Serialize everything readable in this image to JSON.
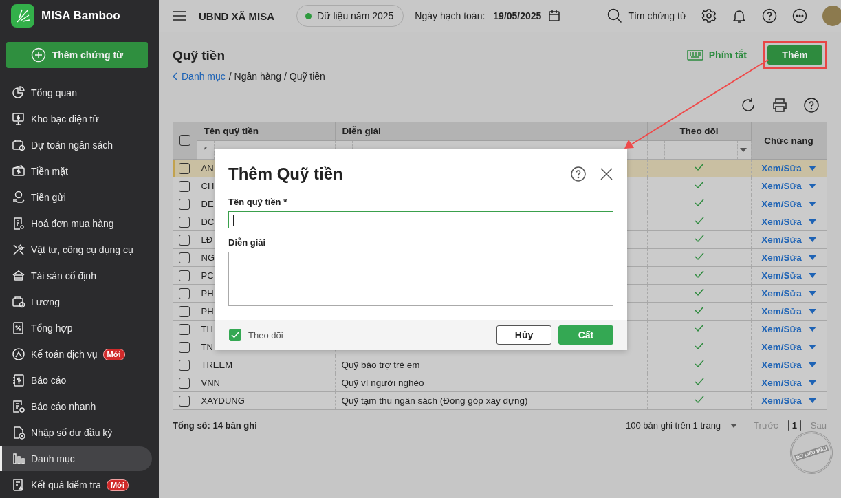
{
  "sidebar": {
    "logo_text": "MISA Bamboo",
    "add_button": "Thêm chứng từ",
    "items": [
      {
        "label": "Tổng quan",
        "selected": false
      },
      {
        "label": "Kho bạc điện tử",
        "selected": false
      },
      {
        "label": "Dự toán ngân sách",
        "selected": false
      },
      {
        "label": "Tiền mặt",
        "selected": false
      },
      {
        "label": "Tiền gửi",
        "selected": false
      },
      {
        "label": "Hoá đơn mua hàng",
        "selected": false
      },
      {
        "label": "Vật tư, công cụ dụng cụ",
        "selected": false
      },
      {
        "label": "Tài sản cố định",
        "selected": false
      },
      {
        "label": "Lương",
        "selected": false
      },
      {
        "label": "Tổng hợp",
        "selected": false
      },
      {
        "label": "Kế toán dịch vụ",
        "badge": "Mới",
        "selected": false
      },
      {
        "label": "Báo cáo",
        "selected": false
      },
      {
        "label": "Báo cáo nhanh",
        "selected": false
      },
      {
        "label": "Nhập số dư đầu kỳ",
        "selected": false
      },
      {
        "label": "Danh mục",
        "selected": true
      },
      {
        "label": "Kết quả kiểm tra",
        "badge": "Mới",
        "selected": false
      }
    ]
  },
  "topbar": {
    "organization": "UBND XÃ MISA",
    "data_year": "Dữ liệu năm 2025",
    "date_label": "Ngày hạch toán:",
    "date_value": "19/05/2025",
    "search_label": "Tìm chứng từ"
  },
  "page": {
    "title": "Quỹ tiền",
    "shortcut_label": "Phím tắt",
    "add_button": "Thêm",
    "highlight_add_button": true,
    "breadcrumb": [
      {
        "label": "Danh mục",
        "link": true
      },
      {
        "label": "/ Ngân hàng / Quỹ tiền",
        "link": false
      }
    ]
  },
  "table": {
    "select_all": false,
    "columns": [
      {
        "label": "Tên quỹ tiền",
        "filter": {
          "kind": "text",
          "op": "*"
        }
      },
      {
        "label": "Diễn giải",
        "filter": {
          "kind": "text"
        }
      },
      {
        "label": "Theo dõi",
        "filter": {
          "kind": "select",
          "op": "="
        }
      },
      {
        "label": "Chức năng"
      }
    ],
    "rows": [
      {
        "name": "AN",
        "selected": true,
        "checked": false,
        "tracked": true,
        "action": "Xem/Sửa"
      },
      {
        "name": "CH",
        "selected": false,
        "checked": false,
        "tracked": true,
        "action": "Xem/Sửa"
      },
      {
        "name": "DE",
        "selected": false,
        "checked": false,
        "tracked": true,
        "action": "Xem/Sửa"
      },
      {
        "name": "DC",
        "selected": false,
        "checked": false,
        "tracked": true,
        "action": "Xem/Sửa"
      },
      {
        "name": "LĐ",
        "selected": false,
        "checked": false,
        "tracked": true,
        "action": "Xem/Sửa"
      },
      {
        "name": "NG",
        "selected": false,
        "checked": false,
        "tracked": true,
        "action": "Xem/Sửa"
      },
      {
        "name": "PC",
        "selected": false,
        "checked": false,
        "tracked": true,
        "action": "Xem/Sửa"
      },
      {
        "name": "PH",
        "selected": false,
        "checked": false,
        "tracked": true,
        "action": "Xem/Sửa"
      },
      {
        "name": "PH",
        "selected": false,
        "checked": false,
        "tracked": true,
        "action": "Xem/Sửa"
      },
      {
        "name": "TH",
        "selected": false,
        "checked": false,
        "tracked": true,
        "action": "Xem/Sửa"
      },
      {
        "name": "TN",
        "selected": false,
        "checked": false,
        "tracked": true,
        "action": "Xem/Sửa"
      },
      {
        "name": "TREEM",
        "description": "Quỹ bảo trợ trẻ em",
        "selected": false,
        "checked": false,
        "tracked": true,
        "action": "Xem/Sửa"
      },
      {
        "name": "VNN",
        "description": "Quỹ vì người nghèo",
        "selected": false,
        "checked": false,
        "tracked": true,
        "action": "Xem/Sửa"
      },
      {
        "name": "XAYDUNG",
        "description": "Quỹ tạm thu ngân sách (Đóng góp xây dựng)",
        "selected": false,
        "checked": false,
        "tracked": true,
        "action": "Xem/Sửa"
      }
    ],
    "total": "Tổng số: 14 bản ghi",
    "page_size": "100 bản ghi trên 1 trang",
    "prev": "Trước",
    "page": "1",
    "next": "Sau"
  },
  "stamp": "DỮ LIỆU MẪU",
  "dialog": {
    "title": "Thêm Quỹ tiền",
    "fields": [
      {
        "label": "Tên quỹ tiền *",
        "kind": "input",
        "focused": true
      },
      {
        "label": "Diễn giải",
        "kind": "textarea",
        "focused": false
      }
    ],
    "tracking": {
      "label": "Theo dõi",
      "checked": true
    },
    "cancel_button": "Hủy",
    "save_button": "Cất"
  }
}
